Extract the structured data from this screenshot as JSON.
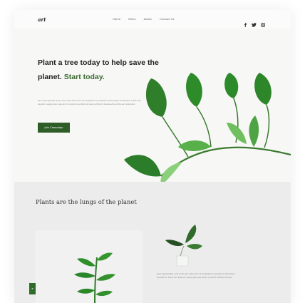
{
  "header": {
    "logo": "art",
    "menu": [
      "Home",
      "Menu",
      "About",
      "Contact Us"
    ],
    "social_icons": [
      "facebook-icon",
      "twitter-icon",
      "instagram-icon"
    ]
  },
  "hero": {
    "headline_main": "Plant a tree today to help save the planet.",
    "headline_accent": "Start today.",
    "body": "Sed ut perspiciatis unde omnis iste natus error sit voluptatem accusantium doloremque laudantium, totam rem aperiam, eaque ipsa quae ab illo inventore veritatis et quasi architecto beatae vitae dicta sunt explicabo.",
    "cta_label": "Join Campaign"
  },
  "section2": {
    "title": "Plants are the lungs of the planet",
    "tab_label": "B",
    "body": "Sed ut perspiciatis unde omnis iste natus error sit voluptatem accusantium doloremque laudantium, totam rem aperiam, eaque ipsa quae ab illo inventore veritatis et quasi."
  },
  "colors": {
    "accent": "#3b6b30",
    "button": "#2f5d28",
    "leaf": "#2e8a2a"
  }
}
